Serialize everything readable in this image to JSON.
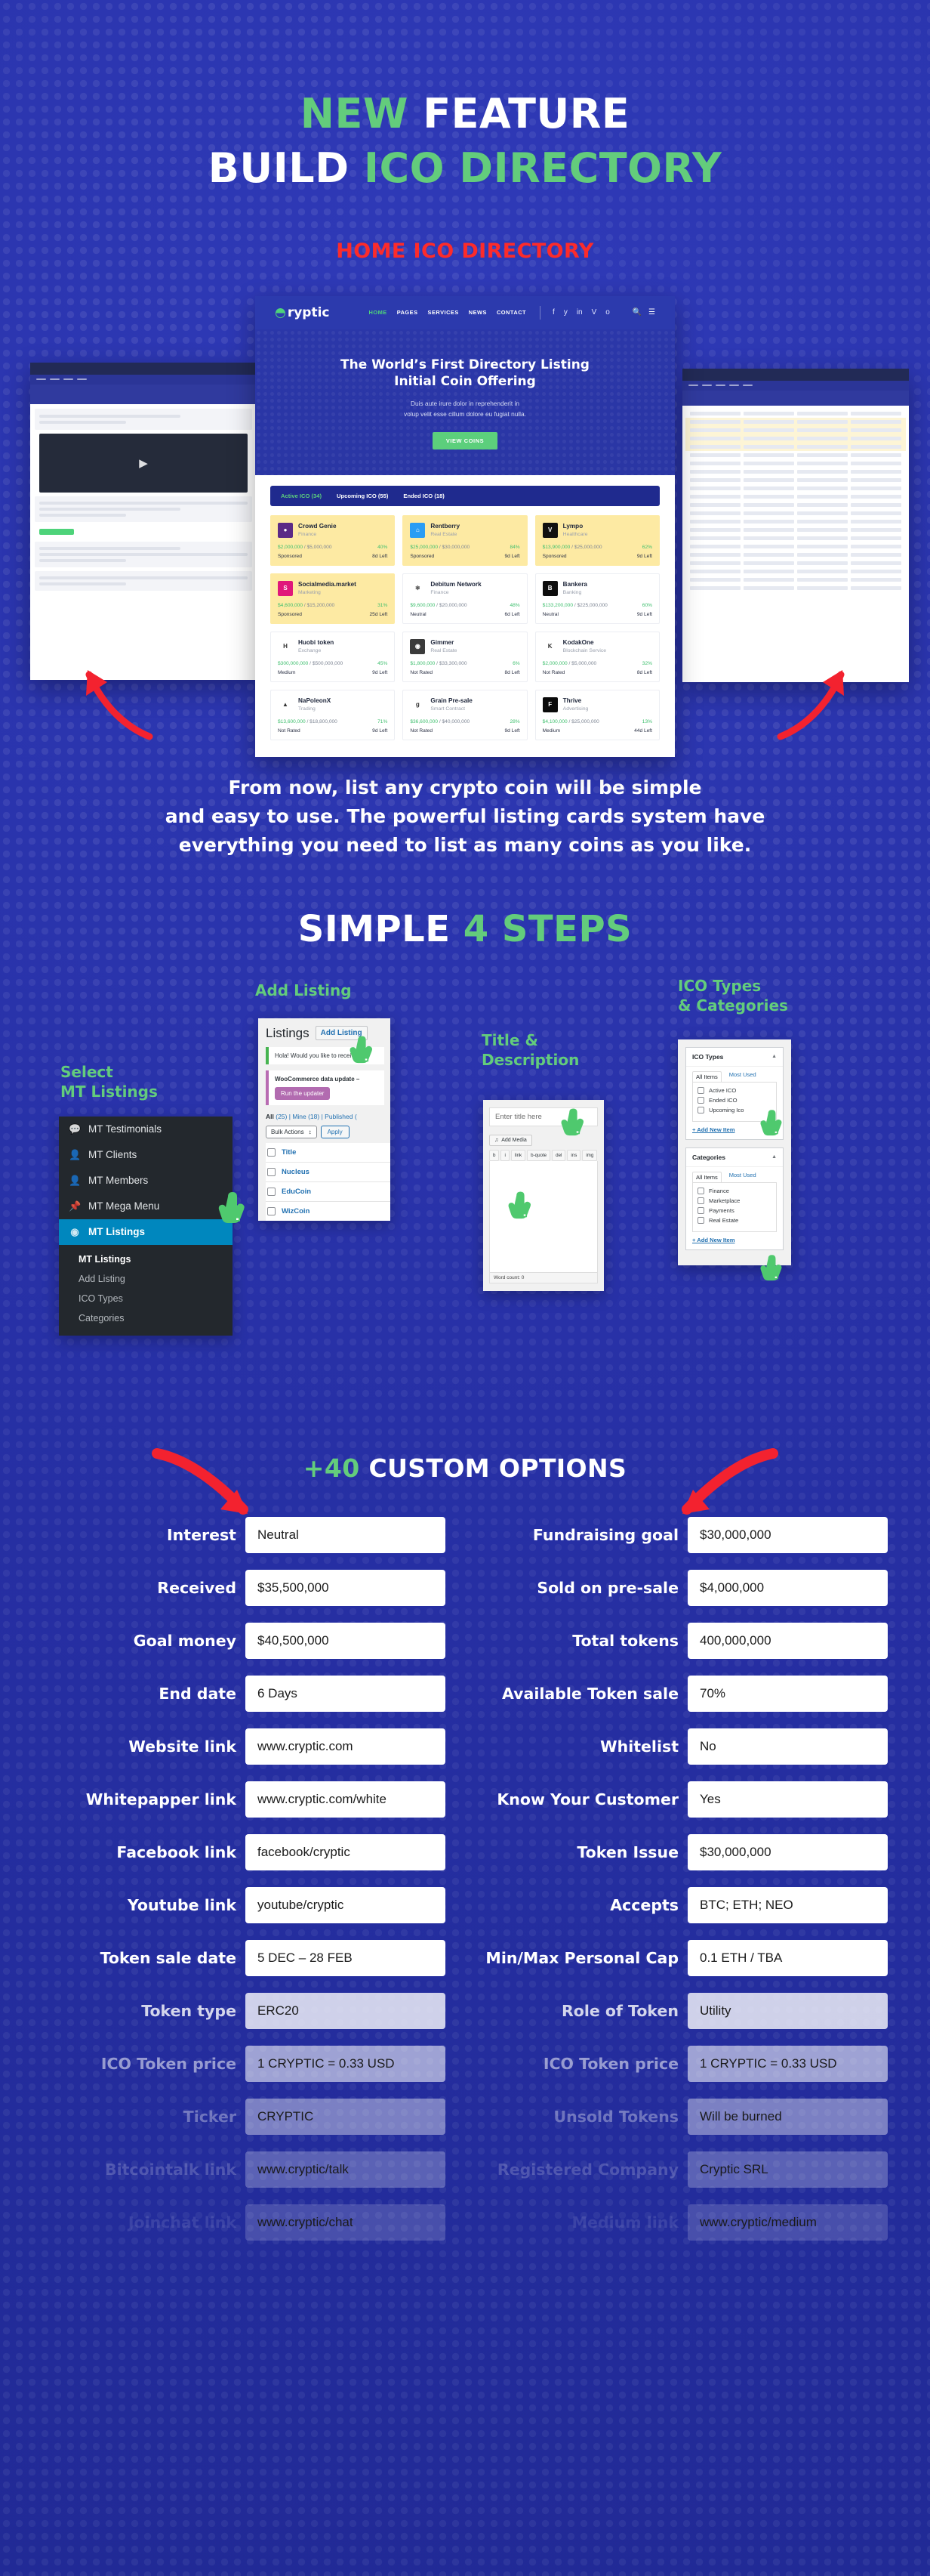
{
  "hero": {
    "line1_green": "NEW",
    "line1_white": "FEATURE",
    "line2_white": "BUILD",
    "line2_green": "ICO DIRECTORY",
    "subheading": "HOME ICO DIRECTORY"
  },
  "browser": {
    "logo": "ryptic",
    "nav": [
      "HOME",
      "PAGES",
      "SERVICES",
      "NEWS",
      "CONTACT"
    ],
    "social": [
      "f",
      "y",
      "in",
      "V",
      "o"
    ],
    "tools": [
      "search-icon",
      "menu-icon"
    ],
    "hero_title_line1": "The World’s First Directory Listing",
    "hero_title_line2": "Initial Coin Offering",
    "hero_sub_line1": "Duis aute irure dolor in reprehenderit in",
    "hero_sub_line2": "volup velit esse cillum dolore eu fugiat nulla.",
    "hero_button": "VIEW COINS",
    "tabs": [
      "Active ICO (34)",
      "Upcoming ICO (55)",
      "Ended ICO (18)"
    ],
    "cards": [
      {
        "name": "Crowd Genie",
        "cat": "Finance",
        "raised": "$2,000,000",
        "goal": "$5,000,000",
        "pct": "40%",
        "rating": "Sponsored",
        "left": "8d Left",
        "sponsored": true,
        "logo_bg": "#5b2a86",
        "logo_text": "●"
      },
      {
        "name": "Rentberry",
        "cat": "Real Estate",
        "raised": "$25,000,000",
        "goal": "$30,000,000",
        "pct": "84%",
        "rating": "Sponsored",
        "left": "9d Left",
        "sponsored": true,
        "logo_bg": "#2a9df4",
        "logo_text": "⌂"
      },
      {
        "name": "Lympo",
        "cat": "Healthcare",
        "raised": "$13,900,000",
        "goal": "$25,000,000",
        "pct": "62%",
        "rating": "Sponsored",
        "left": "9d Left",
        "sponsored": true,
        "logo_bg": "#111111",
        "logo_text": "V"
      },
      {
        "name": "Socialmedia.market",
        "cat": "Marketing",
        "raised": "$4,600,000",
        "goal": "$15,200,000",
        "pct": "31%",
        "rating": "Sponsored",
        "left": "25d Left",
        "sponsored": true,
        "logo_bg": "#e0187a",
        "logo_text": "S"
      },
      {
        "name": "Debitum Network",
        "cat": "Finance",
        "raised": "$9,600,000",
        "goal": "$20,000,000",
        "pct": "48%",
        "rating": "Neutral",
        "left": "6d Left",
        "sponsored": false,
        "logo_bg": "#ffffff",
        "logo_text": "⚛"
      },
      {
        "name": "Bankera",
        "cat": "Banking",
        "raised": "$133,200,000",
        "goal": "$225,000,000",
        "pct": "60%",
        "rating": "Neutral",
        "left": "9d Left",
        "sponsored": false,
        "logo_bg": "#0d0d0d",
        "logo_text": "B"
      },
      {
        "name": "Huobi token",
        "cat": "Exchange",
        "raised": "$300,000,000",
        "goal": "$500,000,000",
        "pct": "45%",
        "rating": "Medium",
        "left": "9d Left",
        "sponsored": false,
        "logo_bg": "#ffffff",
        "logo_text": "H"
      },
      {
        "name": "Gimmer",
        "cat": "Real Estate",
        "raised": "$1,800,000",
        "goal": "$33,300,000",
        "pct": "6%",
        "rating": "Not Rated",
        "left": "8d Left",
        "sponsored": false,
        "logo_bg": "#3b3b3b",
        "logo_text": "◉"
      },
      {
        "name": "KodakOne",
        "cat": "Blockchain Service",
        "raised": "$2,000,000",
        "goal": "$5,000,000",
        "pct": "32%",
        "rating": "Not Rated",
        "left": "8d Left",
        "sponsored": false,
        "logo_bg": "#ffffff",
        "logo_text": "K"
      },
      {
        "name": "NaPoleonX",
        "cat": "Trading",
        "raised": "$13,600,000",
        "goal": "$18,800,000",
        "pct": "71%",
        "rating": "Not Rated",
        "left": "9d Left",
        "sponsored": false,
        "logo_bg": "#ffffff",
        "logo_text": "▲"
      },
      {
        "name": "Grain Pre-sale",
        "cat": "Smart Contract",
        "raised": "$36,600,000",
        "goal": "$40,000,000",
        "pct": "28%",
        "rating": "Not Rated",
        "left": "9d Left",
        "sponsored": false,
        "logo_bg": "#ffffff",
        "logo_text": "g"
      },
      {
        "name": "Thrive",
        "cat": "Advertising",
        "raised": "$4,100,000",
        "goal": "$25,000,000",
        "pct": "13%",
        "rating": "Medium",
        "left": "44d Left",
        "sponsored": false,
        "logo_bg": "#0a0a0a",
        "logo_text": "F"
      }
    ]
  },
  "body_copy": {
    "l1": "From now, list any crypto coin will be simple",
    "l2": "and easy to use. The powerful listing cards system have",
    "l3": "everything you need to list as many coins as you like."
  },
  "steps_heading": {
    "white": "SIMPLE",
    "green": "4 STEPS"
  },
  "steps": {
    "s1_label_l1": "Select",
    "s1_label_l2": "MT Listings",
    "s2_label": "Add Listing",
    "s3_label_l1": "Title &",
    "s3_label_l2": "Description",
    "s4_label_l1": "ICO Types",
    "s4_label_l2": "& Categories"
  },
  "wp_menu": {
    "items": [
      {
        "label": "MT Testimonials",
        "icon": "comment-icon"
      },
      {
        "label": "MT Clients",
        "icon": "user-icon"
      },
      {
        "label": "MT Members",
        "icon": "user-icon"
      },
      {
        "label": "MT Mega Menu",
        "icon": "pin-icon"
      },
      {
        "label": "MT Listings",
        "icon": "dashboard-icon"
      }
    ],
    "sub": [
      "MT Listings",
      "Add Listing",
      "ICO Types",
      "Categories"
    ]
  },
  "listings": {
    "title": "Listings",
    "add_button": "Add Listing",
    "notice": "Hola! Would you like to receive",
    "woo_notice": "WooCommerce data update –",
    "woo_button": "Run the updater",
    "subsub_all": "All",
    "subsub_all_count": "(25)",
    "subsub_mine": "Mine (18)",
    "subsub_published": "Published (",
    "bulk_select": "Bulk Actions",
    "apply": "Apply",
    "rows": [
      "Title",
      "Nucleus",
      "EduCoin",
      "WizCoin"
    ]
  },
  "editor": {
    "title_placeholder": "Enter title here",
    "add_media": "Add Media",
    "toolbar": [
      "b",
      "i",
      "link",
      "b-quote",
      "del",
      "ins",
      "img"
    ],
    "word_count": "Word count: 0"
  },
  "taxonomy": {
    "box1_title": "ICO Types",
    "box1_tab_all": "All Items",
    "box1_tab_most": "Most Used",
    "box1_items": [
      "Active ICO",
      "Ended ICO",
      "Upcoming Ico"
    ],
    "box1_add": "+ Add New Item",
    "box2_title": "Categories",
    "box2_tab_all": "All Items",
    "box2_tab_most": "Most Used",
    "box2_items": [
      "Finance",
      "Marketplace",
      "Payments",
      "Real Estate"
    ],
    "box2_add": "+ Add New Item"
  },
  "options": {
    "plus": "+40",
    "title": "CUSTOM OPTIONS",
    "left": [
      {
        "label": "Interest",
        "value": "Neutral",
        "fade": 0
      },
      {
        "label": "Received",
        "value": "$35,500,000",
        "fade": 0
      },
      {
        "label": "Goal money",
        "value": "$40,500,000",
        "fade": 0
      },
      {
        "label": "End date",
        "value": "6 Days",
        "fade": 0
      },
      {
        "label": "Website link",
        "value": "www.cryptic.com",
        "fade": 0
      },
      {
        "label": "Whitepapper link",
        "value": "www.cryptic.com/white",
        "fade": 0
      },
      {
        "label": "Facebook link",
        "value": "facebook/cryptic",
        "fade": 0
      },
      {
        "label": "Youtube link",
        "value": "youtube/cryptic",
        "fade": 0
      },
      {
        "label": "Token sale date",
        "value": "5 DEC – 28 FEB",
        "fade": 0
      },
      {
        "label": "Token type",
        "value": "ERC20",
        "fade": 1
      },
      {
        "label": "ICO Token price",
        "value": "1 CRYPTIC = 0.33 USD",
        "fade": 2
      },
      {
        "label": "Ticker",
        "value": "CRYPTIC",
        "fade": 3
      },
      {
        "label": "Bitcointalk link",
        "value": "www.cryptic/talk",
        "fade": 4
      },
      {
        "label": "Joinchat link",
        "value": "www.cryptic/chat",
        "fade": 5
      }
    ],
    "right": [
      {
        "label": "Fundraising goal",
        "value": "$30,000,000",
        "fade": 0
      },
      {
        "label": "Sold on pre-sale",
        "value": "$4,000,000",
        "fade": 0
      },
      {
        "label": "Total tokens",
        "value": "400,000,000",
        "fade": 0
      },
      {
        "label": "Available Token sale",
        "value": "70%",
        "fade": 0
      },
      {
        "label": "Whitelist",
        "value": "No",
        "fade": 0
      },
      {
        "label": "Know Your Customer",
        "value": "Yes",
        "fade": 0
      },
      {
        "label": "Token Issue",
        "value": "$30,000,000",
        "fade": 0
      },
      {
        "label": "Accepts",
        "value": "BTC; ETH; NEO",
        "fade": 0
      },
      {
        "label": "Min/Max Personal Cap",
        "value": "0.1 ETH / TBA",
        "fade": 0
      },
      {
        "label": "Role of Token",
        "value": "Utility",
        "fade": 1
      },
      {
        "label": "ICO Token price",
        "value": "1 CRYPTIC = 0.33 USD",
        "fade": 2
      },
      {
        "label": "Unsold Tokens",
        "value": "Will be burned",
        "fade": 3
      },
      {
        "label": "Registered Company",
        "value": "Cryptic SRL",
        "fade": 4
      },
      {
        "label": "Medium link",
        "value": "www.cryptic/medium",
        "fade": 5
      }
    ]
  },
  "colors": {
    "bg_blue": "#2730a8",
    "green": "#63cc7c",
    "red": "#fc2b2b",
    "white": "#ffffff",
    "card_yellow": "#fdeaa3",
    "wp_sidebar": "#23282d",
    "wp_active": "#0087be"
  }
}
